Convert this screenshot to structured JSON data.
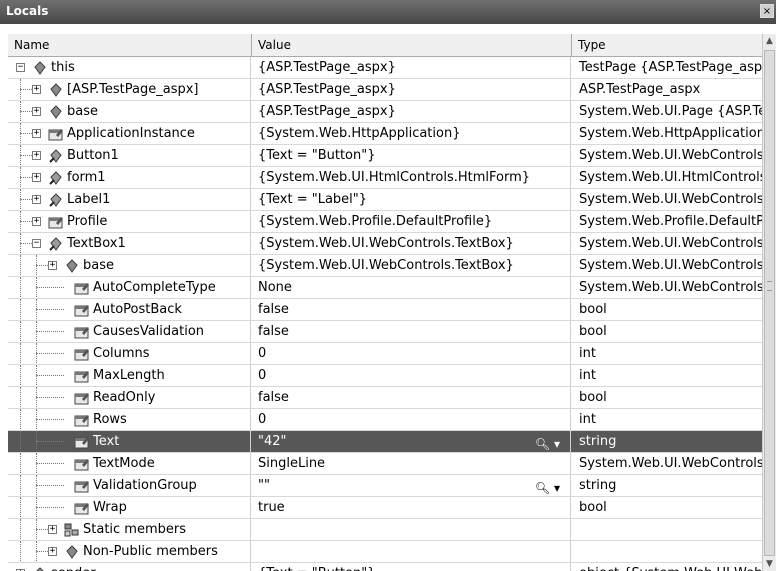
{
  "window": {
    "title": "Locals",
    "close_glyph": "×"
  },
  "columns": {
    "name": "Name",
    "value": "Value",
    "type": "Type"
  },
  "rows": [
    {
      "name": "this",
      "value": "{ASP.TestPage_aspx}",
      "type": "TestPage {ASP.TestPage_aspx}",
      "level": 0,
      "expander": "minus",
      "icon": "field-icon"
    },
    {
      "name": "[ASP.TestPage_aspx]",
      "value": "{ASP.TestPage_aspx}",
      "type": "ASP.TestPage_aspx",
      "level": 1,
      "expander": "plus",
      "icon": "field-icon"
    },
    {
      "name": "base",
      "value": "{ASP.TestPage_aspx}",
      "type": "System.Web.UI.Page {ASP.TestPage_aspx}",
      "level": 1,
      "expander": "plus",
      "icon": "field-icon"
    },
    {
      "name": "ApplicationInstance",
      "value": "{System.Web.HttpApplication}",
      "type": "System.Web.HttpApplication",
      "level": 1,
      "expander": "plus",
      "icon": "property-icon"
    },
    {
      "name": "Button1",
      "value": "{Text = \"Button\"}",
      "type": "System.Web.UI.WebControls.Button",
      "level": 1,
      "expander": "plus",
      "icon": "protected-field-icon"
    },
    {
      "name": "form1",
      "value": "{System.Web.UI.HtmlControls.HtmlForm}",
      "type": "System.Web.UI.HtmlControls.HtmlForm",
      "level": 1,
      "expander": "plus",
      "icon": "protected-field-icon"
    },
    {
      "name": "Label1",
      "value": "{Text = \"Label\"}",
      "type": "System.Web.UI.WebControls.Label",
      "level": 1,
      "expander": "plus",
      "icon": "protected-field-icon"
    },
    {
      "name": "Profile",
      "value": "{System.Web.Profile.DefaultProfile}",
      "type": "System.Web.Profile.DefaultProfile",
      "level": 1,
      "expander": "plus",
      "icon": "property-icon"
    },
    {
      "name": "TextBox1",
      "value": "{System.Web.UI.WebControls.TextBox}",
      "type": "System.Web.UI.WebControls.TextBox",
      "level": 1,
      "expander": "minus",
      "icon": "protected-field-icon"
    },
    {
      "name": "base",
      "value": "{System.Web.UI.WebControls.TextBox}",
      "type": "System.Web.UI.WebControls.WebControl",
      "level": 2,
      "expander": "plus",
      "icon": "field-icon"
    },
    {
      "name": "AutoCompleteType",
      "value": "None",
      "type": "System.Web.UI.WebControls.AutoCompleteType",
      "level": 2,
      "expander": "none",
      "icon": "property-icon"
    },
    {
      "name": "AutoPostBack",
      "value": "false",
      "type": "bool",
      "level": 2,
      "expander": "none",
      "icon": "property-icon"
    },
    {
      "name": "CausesValidation",
      "value": "false",
      "type": "bool",
      "level": 2,
      "expander": "none",
      "icon": "property-icon"
    },
    {
      "name": "Columns",
      "value": "0",
      "type": "int",
      "level": 2,
      "expander": "none",
      "icon": "property-icon"
    },
    {
      "name": "MaxLength",
      "value": "0",
      "type": "int",
      "level": 2,
      "expander": "none",
      "icon": "property-icon"
    },
    {
      "name": "ReadOnly",
      "value": "false",
      "type": "bool",
      "level": 2,
      "expander": "none",
      "icon": "property-icon"
    },
    {
      "name": "Rows",
      "value": "0",
      "type": "int",
      "level": 2,
      "expander": "none",
      "icon": "property-icon"
    },
    {
      "name": "Text",
      "value": "\"42\"",
      "type": "string",
      "level": 2,
      "expander": "none",
      "icon": "property-icon",
      "selected": true,
      "visualizer": true
    },
    {
      "name": "TextMode",
      "value": "SingleLine",
      "type": "System.Web.UI.WebControls.TextBoxMode",
      "level": 2,
      "expander": "none",
      "icon": "property-icon"
    },
    {
      "name": "ValidationGroup",
      "value": "\"\"",
      "type": "string",
      "level": 2,
      "expander": "none",
      "icon": "property-icon",
      "visualizer": true
    },
    {
      "name": "Wrap",
      "value": "true",
      "type": "bool",
      "level": 2,
      "expander": "none",
      "icon": "property-icon"
    },
    {
      "name": "Static members",
      "value": "",
      "type": "",
      "level": 2,
      "expander": "plus",
      "icon": "static-members-icon"
    },
    {
      "name": "Non-Public members",
      "value": "",
      "type": "",
      "level": 2,
      "expander": "plus",
      "icon": "field-icon"
    },
    {
      "name": "sender",
      "value": "{Text = \"Button\"}",
      "type": "object {System.Web.UI.WebControls.Button}",
      "level": 0,
      "expander": "plus",
      "icon": "field-icon"
    }
  ],
  "icons": {
    "magnifier": "🔍︎",
    "dropdown": "▾",
    "plus": "+",
    "minus": "−",
    "scroll_up": "▲",
    "scroll_down": "▼"
  },
  "colors": {
    "selected_row": "#575757",
    "titlebar": "#555555"
  }
}
